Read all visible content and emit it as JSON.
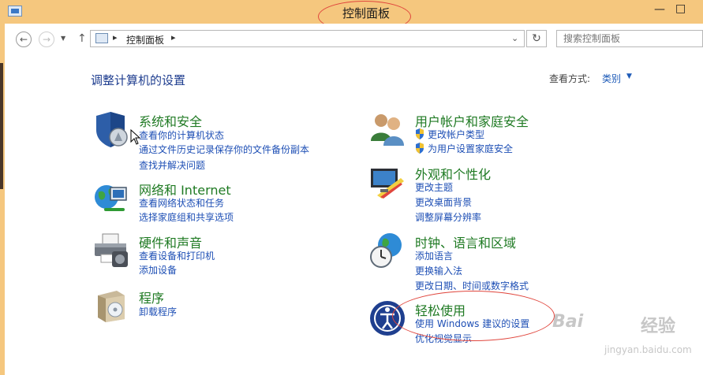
{
  "window": {
    "title": "控制面板",
    "minimize_icon": "minimize-icon",
    "maximize_icon": "maximize-icon"
  },
  "nav": {
    "back_icon": "back-arrow-icon",
    "forward_icon": "forward-arrow-icon",
    "up_icon": "up-arrow-icon",
    "refresh_icon": "refresh-icon"
  },
  "address": {
    "crumb": "控制面板"
  },
  "search": {
    "placeholder": "搜索控制面板"
  },
  "page": {
    "heading": "调整计算机的设置",
    "view_label": "查看方式:",
    "view_value": "类别"
  },
  "left_categories": [
    {
      "title": "系统和安全",
      "links": [
        "查看你的计算机状态",
        "通过文件历史记录保存你的文件备份副本",
        "查找并解决问题"
      ]
    },
    {
      "title": "网络和 Internet",
      "links": [
        "查看网络状态和任务",
        "选择家庭组和共享选项"
      ]
    },
    {
      "title": "硬件和声音",
      "links": [
        "查看设备和打印机",
        "添加设备"
      ]
    },
    {
      "title": "程序",
      "links": [
        "卸载程序"
      ]
    }
  ],
  "right_categories": [
    {
      "title": "用户帐户和家庭安全",
      "links": [
        "更改帐户类型",
        "为用户设置家庭安全"
      ]
    },
    {
      "title": "外观和个性化",
      "links": [
        "更改主题",
        "更改桌面背景",
        "调整屏幕分辨率"
      ]
    },
    {
      "title": "时钟、语言和区域",
      "links": [
        "添加语言",
        "更换输入法",
        "更改日期、时间或数字格式"
      ]
    },
    {
      "title": "轻松使用",
      "links": [
        "使用 Windows 建议的设置",
        "优化视觉显示"
      ]
    }
  ],
  "watermark": {
    "brand_a": "Bai",
    "brand_b": "经验",
    "url": "jingyan.baidu.com"
  },
  "colors": {
    "titlebar": "#f5c77e",
    "category_title": "#1f7a23",
    "link": "#1e4fb5",
    "heading": "#1e3d8f",
    "annotation": "#e0463d"
  }
}
